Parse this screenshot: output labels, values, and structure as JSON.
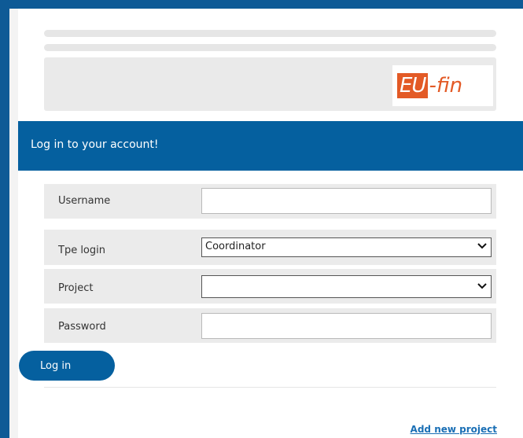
{
  "logo": {
    "part1": "EU",
    "part2": "-fin"
  },
  "header": {
    "title": "Log in to your account!"
  },
  "form": {
    "username_label": "Username",
    "username_value": "",
    "login_type_label": "Tpe login",
    "login_type_value": "Coordinator",
    "project_label": "Project",
    "project_value": "",
    "password_label": "Password",
    "password_value": ""
  },
  "actions": {
    "login_label": "Log in",
    "add_project_label": "Add new project"
  },
  "colors": {
    "brand_blue": "#05609f",
    "logo_orange": "#e35a26"
  },
  "icons": {
    "select_chevron": "chevron-down-icon"
  }
}
